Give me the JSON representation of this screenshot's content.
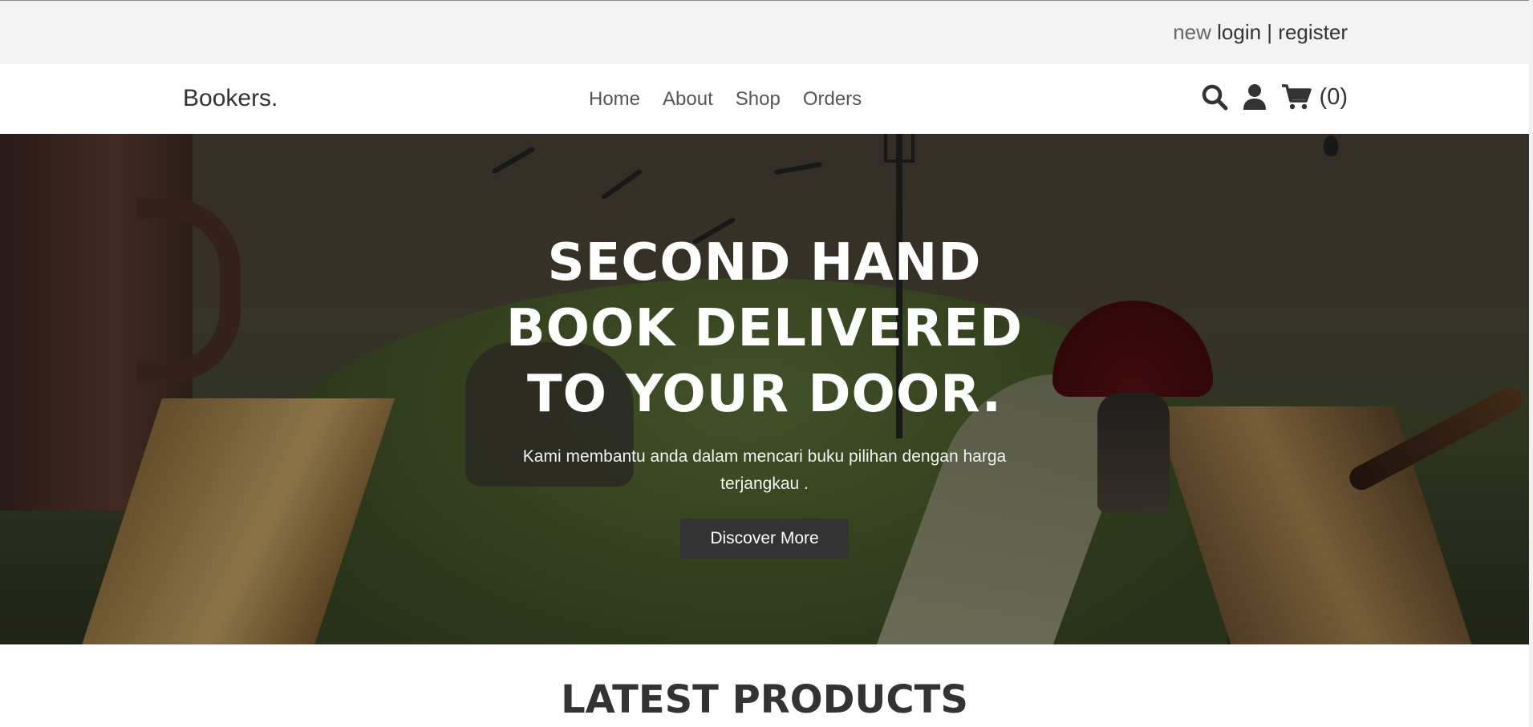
{
  "topbar": {
    "new_label": "new",
    "login_label": "login",
    "separator": "|",
    "register_label": "register"
  },
  "header": {
    "logo": "Bookers.",
    "nav": [
      {
        "label": "Home"
      },
      {
        "label": "About"
      },
      {
        "label": "Shop"
      },
      {
        "label": "Orders"
      }
    ],
    "cart_count": "(0)"
  },
  "hero": {
    "title": "SECOND HAND BOOK DELIVERED TO YOUR DOOR.",
    "subtitle": "Kami membantu anda dalam mencari buku pilihan dengan harga terjangkau .",
    "button_label": "Discover More"
  },
  "latest": {
    "title": "LATEST PRODUCTS"
  },
  "icons": {
    "search": "search-icon",
    "user": "user-icon",
    "cart": "cart-icon"
  },
  "colors": {
    "topbar_bg": "#f3f3f3",
    "text": "#333333",
    "button_bg": "#333333"
  }
}
